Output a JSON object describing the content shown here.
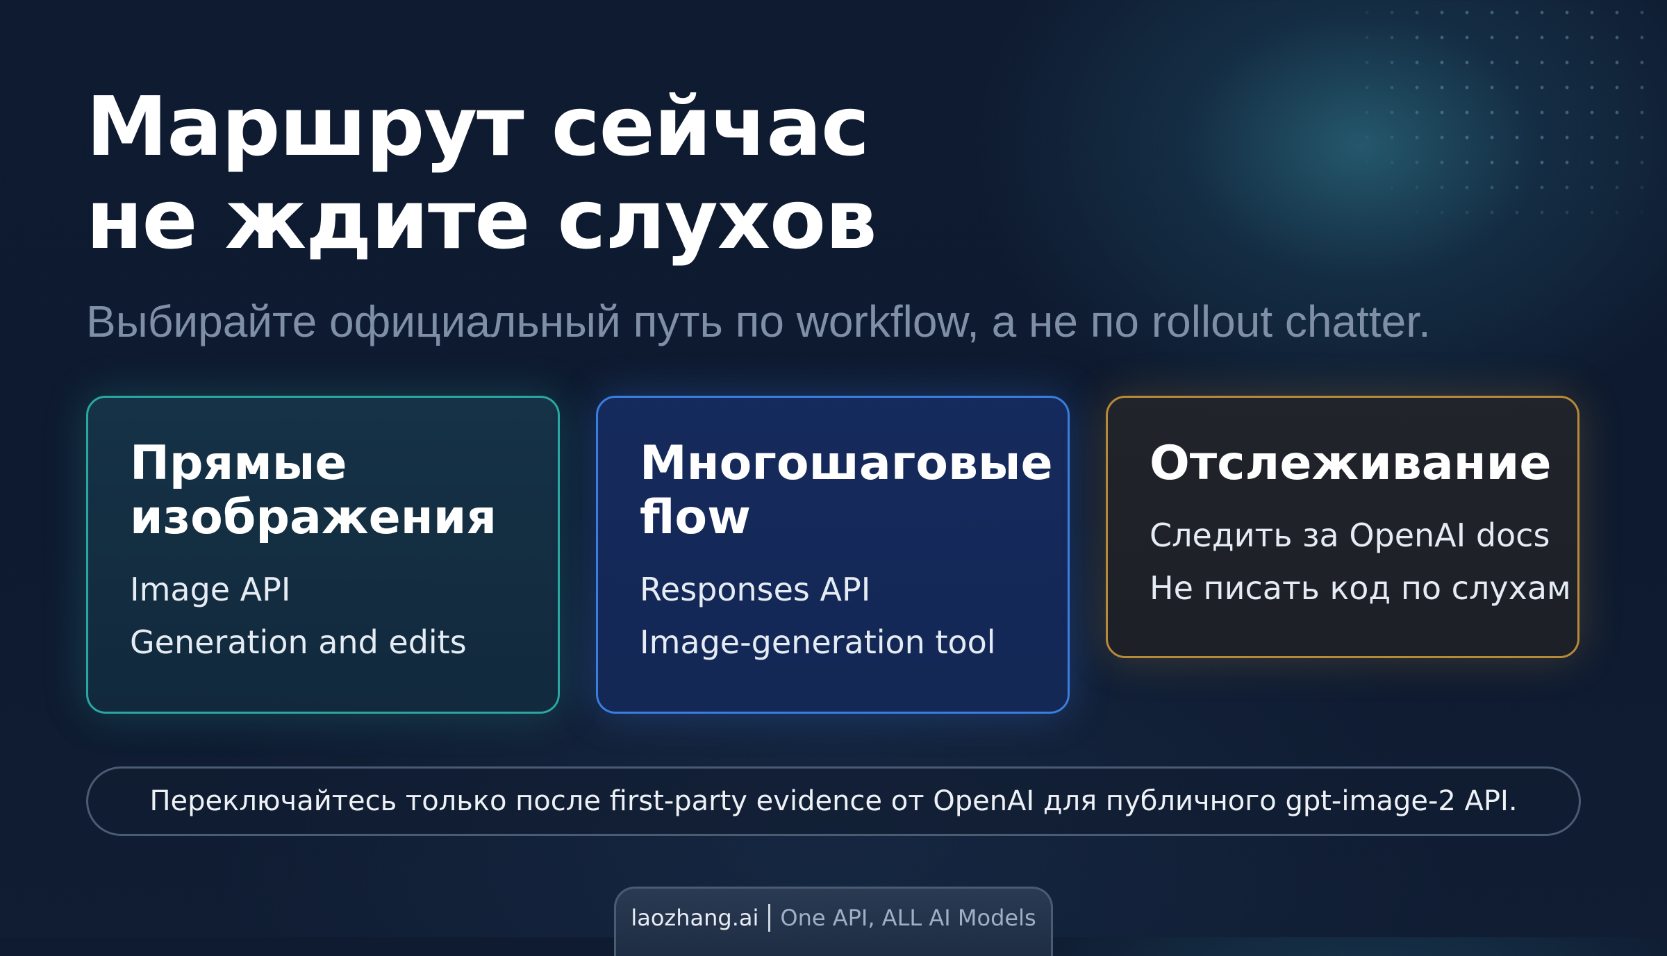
{
  "title": {
    "line1": "Маршрут сейчас",
    "line2": "не ждите слухов"
  },
  "subtitle": "Выбирайте официальный путь по workflow, а не по rollout chatter.",
  "cards": [
    {
      "heading": "Прямые изображения",
      "lines": [
        "Image API",
        "Generation and edits"
      ],
      "accent": "#2aa8a0"
    },
    {
      "heading": "Многошаговые flow",
      "lines": [
        "Responses API",
        "Image-generation tool"
      ],
      "accent": "#3a7ee0"
    },
    {
      "heading": "Отслеживание",
      "lines": [
        "Следить за OpenAI docs",
        "Не писать код по слухам"
      ],
      "accent": "#b78a3a"
    }
  ],
  "banner": "Переключайтесь только после first-party evidence от OpenAI для публичного gpt-image-2 API.",
  "footer": {
    "brand": "laozhang.ai",
    "tagline": "One API, ALL AI Models"
  }
}
